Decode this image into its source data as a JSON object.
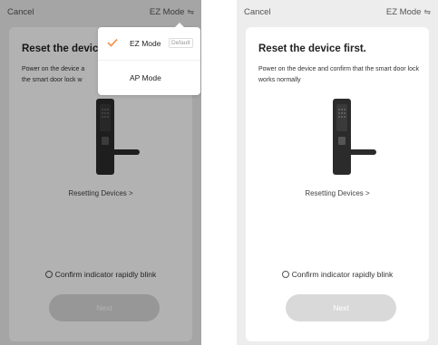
{
  "left_screen": {
    "cancel": "Cancel",
    "mode_label": "EZ Mode",
    "mode_icon": "⇋",
    "title": "Reset the device",
    "description": "Power on the device a... the smart door lock w...",
    "resetting": "Resetting Devices >",
    "confirm": "Confirm indicator rapidly blink",
    "next": "Next",
    "dropdown": {
      "items": [
        {
          "label": "EZ Mode",
          "badge": "Default",
          "selected": true
        },
        {
          "label": "AP Mode",
          "selected": false
        }
      ],
      "check_color": "#f5843b"
    }
  },
  "right_screen": {
    "cancel": "Cancel",
    "mode_label": "EZ Mode",
    "mode_icon": "⇋",
    "title": "Reset the device first.",
    "description": "Power on the device and confirm that the smart door lock works normally",
    "resetting": "Resetting Devices >",
    "confirm": "Confirm indicator rapidly blink",
    "next": "Next"
  },
  "colors": {
    "background": "#ededed",
    "card": "#ffffff",
    "next_button": "#d9d9d9",
    "accent_check": "#f5843b",
    "lock_body": "#2b2b2b"
  },
  "icons": {
    "mode_toggle": "swap-arrows-icon",
    "check": "checkmark-icon",
    "lock": "smart-door-lock-icon",
    "radio": "radio-circle-icon"
  }
}
